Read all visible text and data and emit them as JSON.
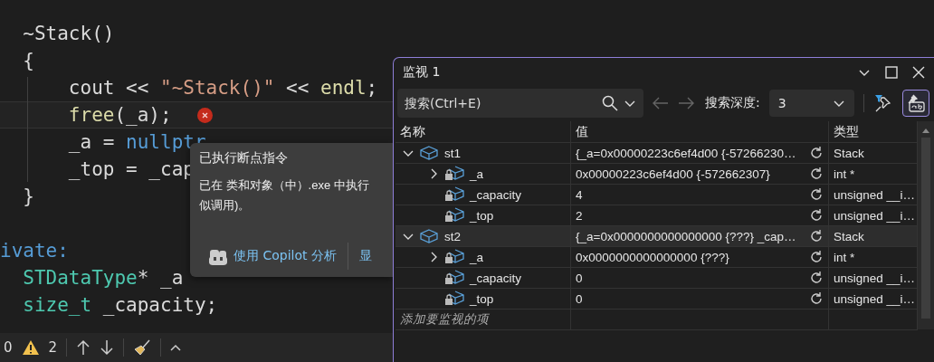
{
  "editor": {
    "lines": [
      {
        "tokens": [
          {
            "kind": "plain",
            "text": "  ~Stack()"
          }
        ]
      },
      {
        "tokens": [
          {
            "kind": "plain",
            "text": "  {"
          }
        ]
      },
      {
        "tokens": [
          {
            "kind": "plain",
            "text": "      cout << "
          },
          {
            "kind": "string",
            "text": "\"~Stack()\""
          },
          {
            "kind": "plain",
            "text": " << "
          },
          {
            "kind": "func",
            "text": "endl"
          },
          {
            "kind": "plain",
            "text": ";"
          }
        ]
      },
      {
        "current": true,
        "error": true,
        "tokens": [
          {
            "kind": "func",
            "text": "      free"
          },
          {
            "kind": "plain",
            "text": "(_a);"
          }
        ]
      },
      {
        "tokens": [
          {
            "kind": "plain",
            "text": "      _a = "
          },
          {
            "kind": "keyword",
            "text": "nullptr"
          }
        ]
      },
      {
        "tokens": [
          {
            "kind": "plain",
            "text": "      _top = _cap"
          }
        ]
      },
      {
        "tokens": [
          {
            "kind": "plain",
            "text": "  }"
          }
        ]
      },
      {
        "kind": "blank"
      },
      {
        "tokens": [
          {
            "kind": "keyword",
            "text": "ivate:"
          }
        ]
      },
      {
        "tokens": [
          {
            "kind": "type",
            "text": "  STDataType"
          },
          {
            "kind": "plain",
            "text": "* _a"
          }
        ]
      },
      {
        "tokens": [
          {
            "kind": "type",
            "text": "  size_t"
          },
          {
            "kind": "plain",
            "text": " _capacity;"
          }
        ]
      }
    ]
  },
  "status_bar": {
    "errors": "0",
    "warnings": "2"
  },
  "popup": {
    "title": "已执行断点指令",
    "lines": [
      "已在 类和对象（中）.exe 中执行",
      "似调用)。"
    ],
    "buttons": [
      "使用 Copilot 分析",
      "显"
    ]
  },
  "watch": {
    "title": "监视 1",
    "search": {
      "placeholder": "搜索(Ctrl+E)"
    },
    "depth_label": "搜索深度:",
    "depth": "3",
    "toggle_on": true,
    "columns": [
      "名称",
      "值",
      "类型"
    ],
    "rows": [
      {
        "name": "st1",
        "kind": "object",
        "value": "{_a=0x00000223c6ef4d00 {-57266230…",
        "type": "Stack",
        "expanded": true,
        "selected": false,
        "children": [
          {
            "name": "_a",
            "kind": "private",
            "value": "0x00000223c6ef4d00 {-572662307}",
            "type": "int *",
            "expanded": false,
            "selected": false
          },
          {
            "name": "_capacity",
            "kind": "private",
            "value": "4",
            "type": "unsigned __i…",
            "selected": false
          },
          {
            "name": "_top",
            "kind": "private",
            "value": "2",
            "type": "unsigned __i…",
            "selected": false
          }
        ]
      },
      {
        "name": "st2",
        "kind": "object",
        "value": "{_a=0x0000000000000000 {???} _cap…",
        "type": "Stack",
        "expanded": true,
        "selected": true,
        "children": [
          {
            "name": "_a",
            "kind": "private",
            "value": "0x0000000000000000 {???}",
            "type": "int *",
            "expanded": false,
            "selected": false
          },
          {
            "name": "_capacity",
            "kind": "private",
            "value": "0",
            "type": "unsigned __i…",
            "selected": false
          },
          {
            "name": "_top",
            "kind": "private",
            "value": "0",
            "type": "unsigned __i…",
            "selected": false
          }
        ]
      }
    ],
    "add_placeholder": "添加要监视的项"
  }
}
